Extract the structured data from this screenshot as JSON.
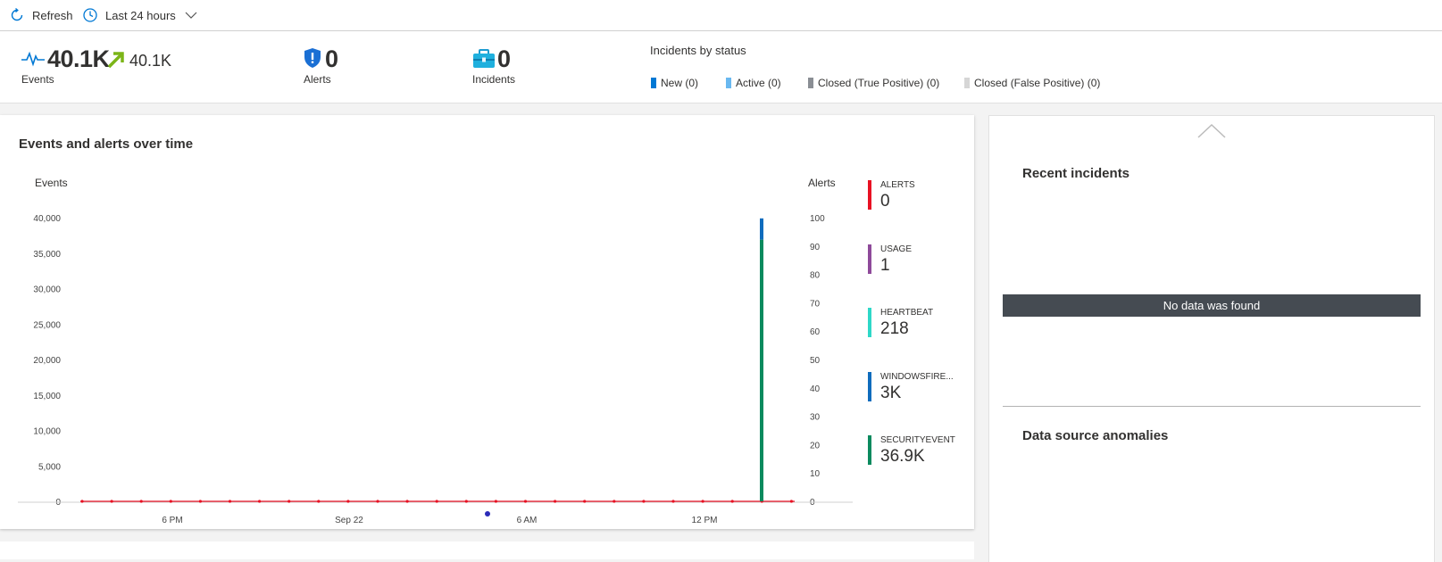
{
  "toolbar": {
    "refresh_label": "Refresh",
    "time_range_label": "Last 24 hours"
  },
  "summary": {
    "events": {
      "value": "40.1K",
      "trend_value": "40.1K",
      "label": "Events"
    },
    "alerts": {
      "value": "0",
      "label": "Alerts"
    },
    "incidents": {
      "value": "0",
      "label": "Incidents"
    },
    "incidents_by_status": {
      "title": "Incidents by status",
      "items": [
        {
          "label": "New (0)",
          "color": "#0078d4"
        },
        {
          "label": "Active (0)",
          "color": "#69b8f0"
        },
        {
          "label": "Closed (True Positive) (0)",
          "color": "#8a8e94"
        },
        {
          "label": "Closed (False Positive) (0)",
          "color": "#d6d6d6"
        }
      ]
    }
  },
  "events_panel": {
    "title": "Events and alerts over time",
    "legend": [
      {
        "name": "ALERTS",
        "value": "0",
        "color": "#e81123"
      },
      {
        "name": "USAGE",
        "value": "1",
        "color": "#8e4a9a"
      },
      {
        "name": "HEARTBEAT",
        "value": "218",
        "color": "#2ed8c8"
      },
      {
        "name": "WINDOWSFIRE...",
        "value": "3K",
        "color": "#0f6cbd"
      },
      {
        "name": "SECURITYEVENT",
        "value": "36.9K",
        "color": "#0b8a5e"
      }
    ]
  },
  "chart_data": {
    "type": "bar",
    "ylabel": "Events",
    "ylabel_right": "Alerts",
    "ylim": [
      0,
      40000
    ],
    "ylim_right": [
      0,
      100
    ],
    "yticks": [
      "0",
      "5,000",
      "10,000",
      "15,000",
      "20,000",
      "25,000",
      "30,000",
      "35,000",
      "40,000"
    ],
    "yticks_right": [
      "0",
      "10",
      "20",
      "30",
      "40",
      "50",
      "60",
      "70",
      "80",
      "90",
      "100"
    ],
    "xticks": [
      "6 PM",
      "Sep 22",
      "6 AM",
      "12 PM"
    ],
    "series": [
      {
        "name": "SECURITYEVENT",
        "color": "#0b8a5e",
        "spike_value": 36900
      },
      {
        "name": "WINDOWSFIRE...",
        "color": "#0f6cbd",
        "spike_value": 3000
      },
      {
        "name": "ALERTS",
        "color": "#e81123",
        "values_constant": 0
      }
    ]
  },
  "incidents_panel": {
    "title": "Recent incidents",
    "no_data_text": "No data was found",
    "anomalies_title": "Data source anomalies"
  }
}
